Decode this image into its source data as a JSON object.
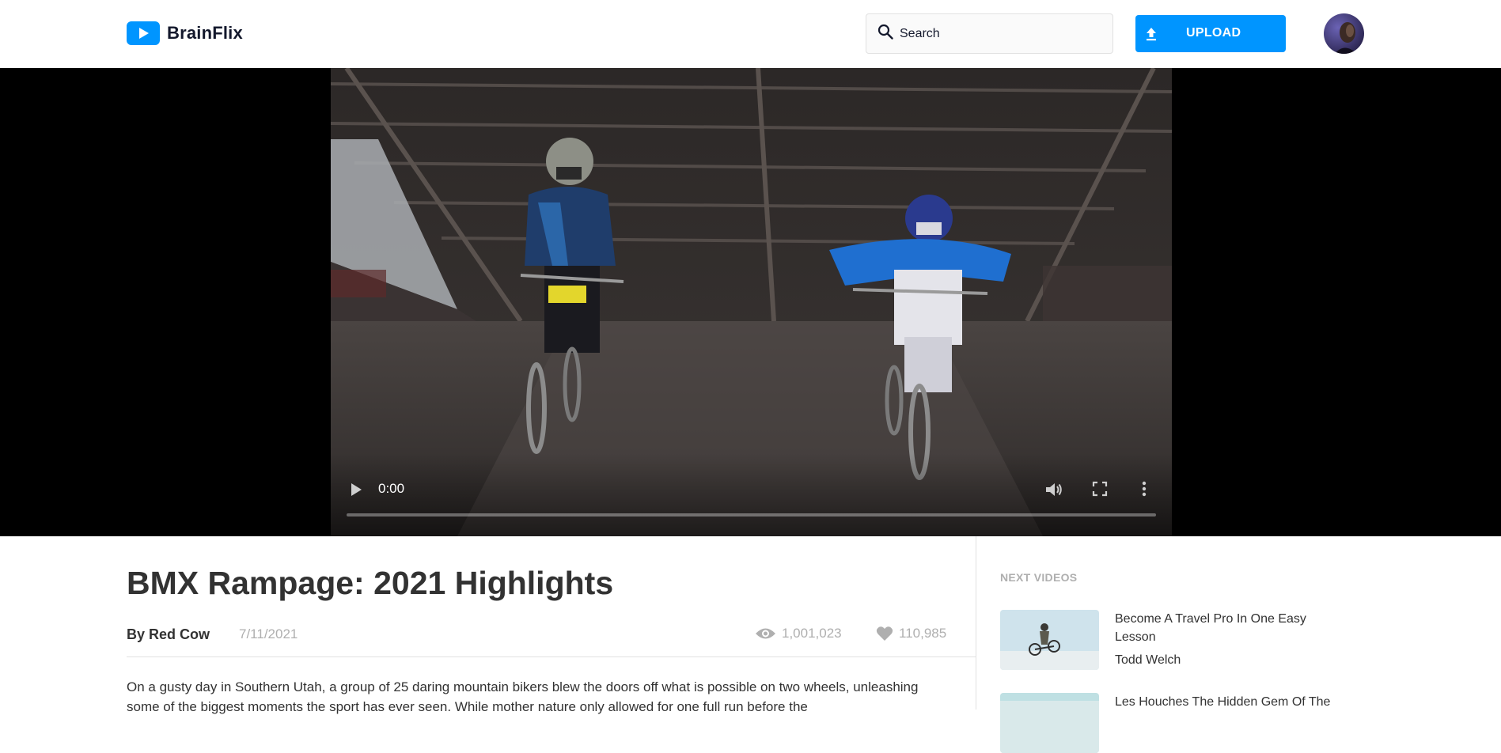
{
  "header": {
    "logo_text": "BrainFlix",
    "search_placeholder": "Search",
    "upload_label": "UPLOAD"
  },
  "player": {
    "current_time": "0:00",
    "progress": 0
  },
  "video": {
    "title": "BMX Rampage: 2021 Highlights",
    "channel": "By Red Cow",
    "date": "7/11/2021",
    "views": "1,001,023",
    "likes": "110,985",
    "description": "On a gusty day in Southern Utah, a group of 25 daring mountain bikers blew the doors off what is possible on two wheels, unleashing some of the biggest moments the sport has ever seen. While mother nature only allowed for one full run before the"
  },
  "next_videos": {
    "heading": "NEXT VIDEOS",
    "items": [
      {
        "title": "Become A Travel Pro In One Easy Lesson",
        "channel": "Todd Welch"
      },
      {
        "title": "Les Houches The Hidden Gem Of The",
        "channel": ""
      }
    ]
  },
  "colors": {
    "accent": "#0095ff",
    "text": "#323232",
    "muted": "#afafaf",
    "border": "#e1e1e1"
  },
  "icons": {
    "logo": "play-icon",
    "search": "search-icon",
    "upload": "upload-icon",
    "views": "eye-icon",
    "likes": "heart-icon",
    "player": [
      "play-icon",
      "volume-icon",
      "fullscreen-icon",
      "more-vertical-icon"
    ]
  }
}
